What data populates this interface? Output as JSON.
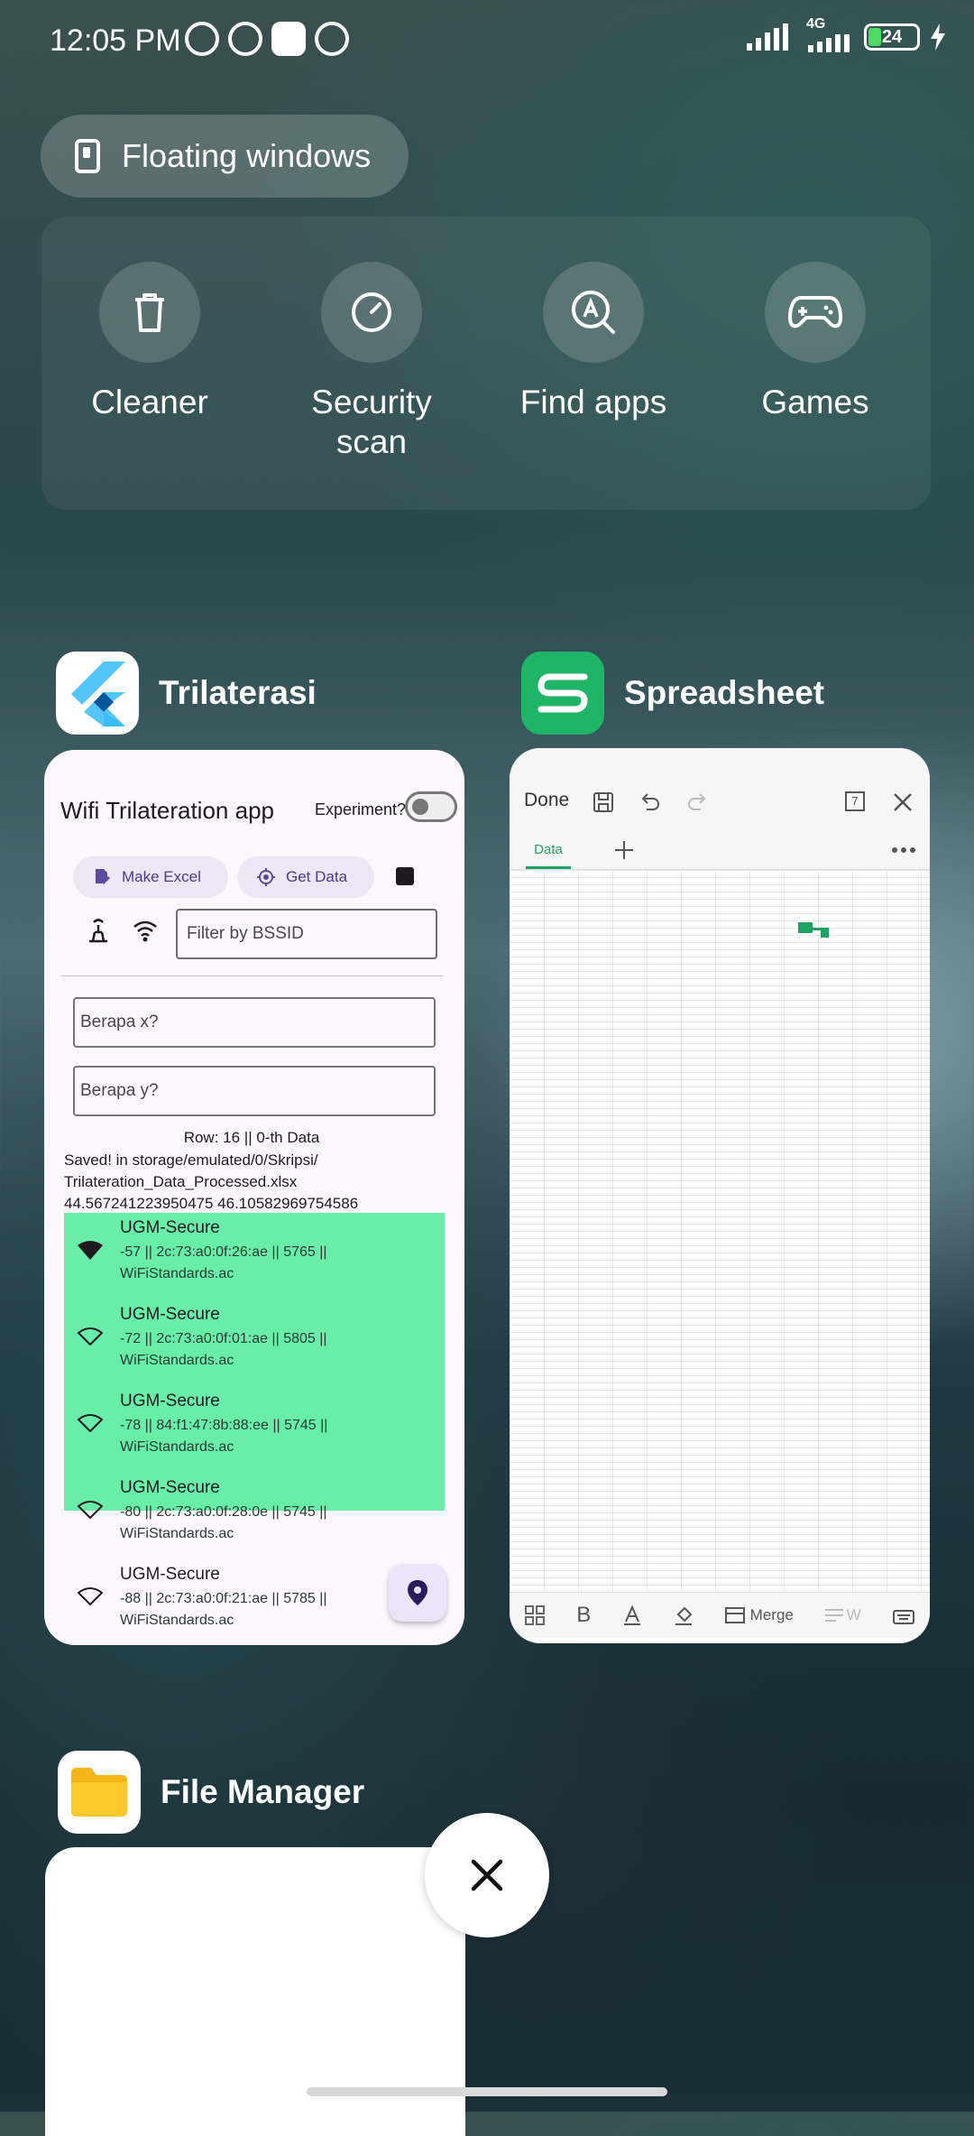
{
  "status_bar": {
    "time": "12:05 PM",
    "network": "4G",
    "battery": "24"
  },
  "floating_windows": {
    "label": "Floating windows"
  },
  "quick_actions": [
    {
      "label": "Cleaner",
      "icon": "trash-icon"
    },
    {
      "label": "Security scan",
      "icon": "security-scan-icon"
    },
    {
      "label": "Find apps",
      "icon": "find-apps-icon"
    },
    {
      "label": "Games",
      "icon": "gamepad-icon"
    }
  ],
  "apps": {
    "trilaterasi": {
      "name": "Trilaterasi",
      "screen": {
        "title": "Wifi Trilateration app",
        "experiment_label": "Experiment?",
        "make_excel": "Make Excel",
        "get_data": "Get Data",
        "filter_placeholder": "Filter by BSSID",
        "x_placeholder": "Berapa x?",
        "y_placeholder": "Berapa y?",
        "row_text": "Row: 16  ||   0-th Data",
        "saved_text": "Saved! in storage/emulated/0/Skripsi/ Trilateration_Data_Processed.xlsx",
        "coords_text": "44.567241223950475 46.10582969754586",
        "wifi_list": [
          {
            "ssid": "UGM-Secure",
            "detail": "-57 || 2c:73:a0:0f:26:ae || 5765 || WiFiStandards.ac"
          },
          {
            "ssid": "UGM-Secure",
            "detail": "-72 || 2c:73:a0:0f:01:ae || 5805 || WiFiStandards.ac"
          },
          {
            "ssid": "UGM-Secure",
            "detail": "-78 || 84:f1:47:8b:88:ee || 5745 || WiFiStandards.ac"
          },
          {
            "ssid": "UGM-Secure",
            "detail": "-80 || 2c:73:a0:0f:28:0e || 5745 || WiFiStandards.ac"
          },
          {
            "ssid": "UGM-Secure",
            "detail": "-88 || 2c:73:a0:0f:21:ae || 5785 || WiFiStandards.ac"
          }
        ]
      }
    },
    "spreadsheet": {
      "name": "Spreadsheet",
      "screen": {
        "done": "Done",
        "sheet_tab": "Data",
        "page_count": "7",
        "toolbar": {
          "bold": "B",
          "merge": "Merge",
          "wrap": "W"
        }
      }
    },
    "file_manager": {
      "name": "File Manager"
    }
  },
  "colors": {
    "wifi_list_bg": "#69eea9",
    "spreadsheet_brand": "#1ea362",
    "flutter_blue": "#54c5f8"
  }
}
